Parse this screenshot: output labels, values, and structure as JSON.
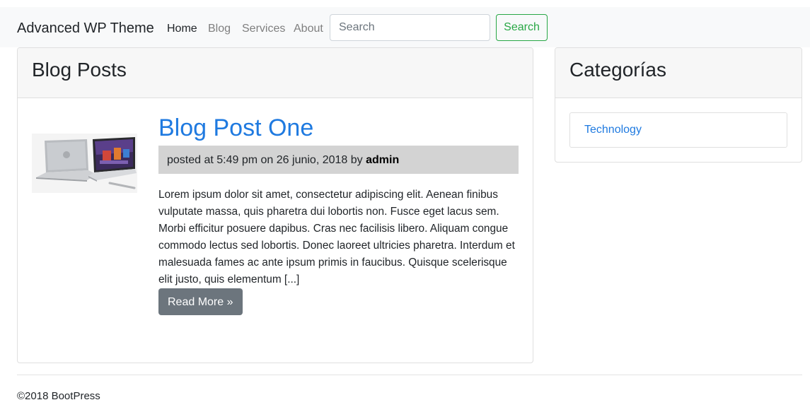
{
  "navbar": {
    "brand": "Advanced WP Theme",
    "links": [
      {
        "label": "Home",
        "active": true
      },
      {
        "label": "Blog",
        "active": false
      },
      {
        "label": "Services",
        "active": false
      },
      {
        "label": "About",
        "active": false
      }
    ],
    "search_placeholder": "Search",
    "search_button": "Search"
  },
  "main": {
    "header": "Blog Posts",
    "post": {
      "title": "Blog Post One",
      "meta_prefix": "posted at 5:49 pm on 26 junio, 2018 by ",
      "author": "admin",
      "excerpt": "Lorem ipsum dolor sit amet, consectetur adipiscing elit. Aenean finibus vulputate massa, quis pharetra dui lobortis non. Fusce eget lacus sem. Morbi efficitur posuere dapibus. Cras nec facilisis libero. Aliquam congue commodo lectus sed lobortis. Donec laoreet ultricies pharetra. Interdum et malesuada fames ac ante ipsum primis in faucibus. Quisque scelerisque elit justo, quis elementum [...]",
      "read_more": "Read More »"
    }
  },
  "sidebar": {
    "header": "Categorías",
    "categories": [
      "Technology"
    ]
  },
  "footer": {
    "text": "©2018 BootPress"
  },
  "colors": {
    "accent": "#1f7ae0",
    "success": "#28a745",
    "secondary": "#6c757d"
  }
}
